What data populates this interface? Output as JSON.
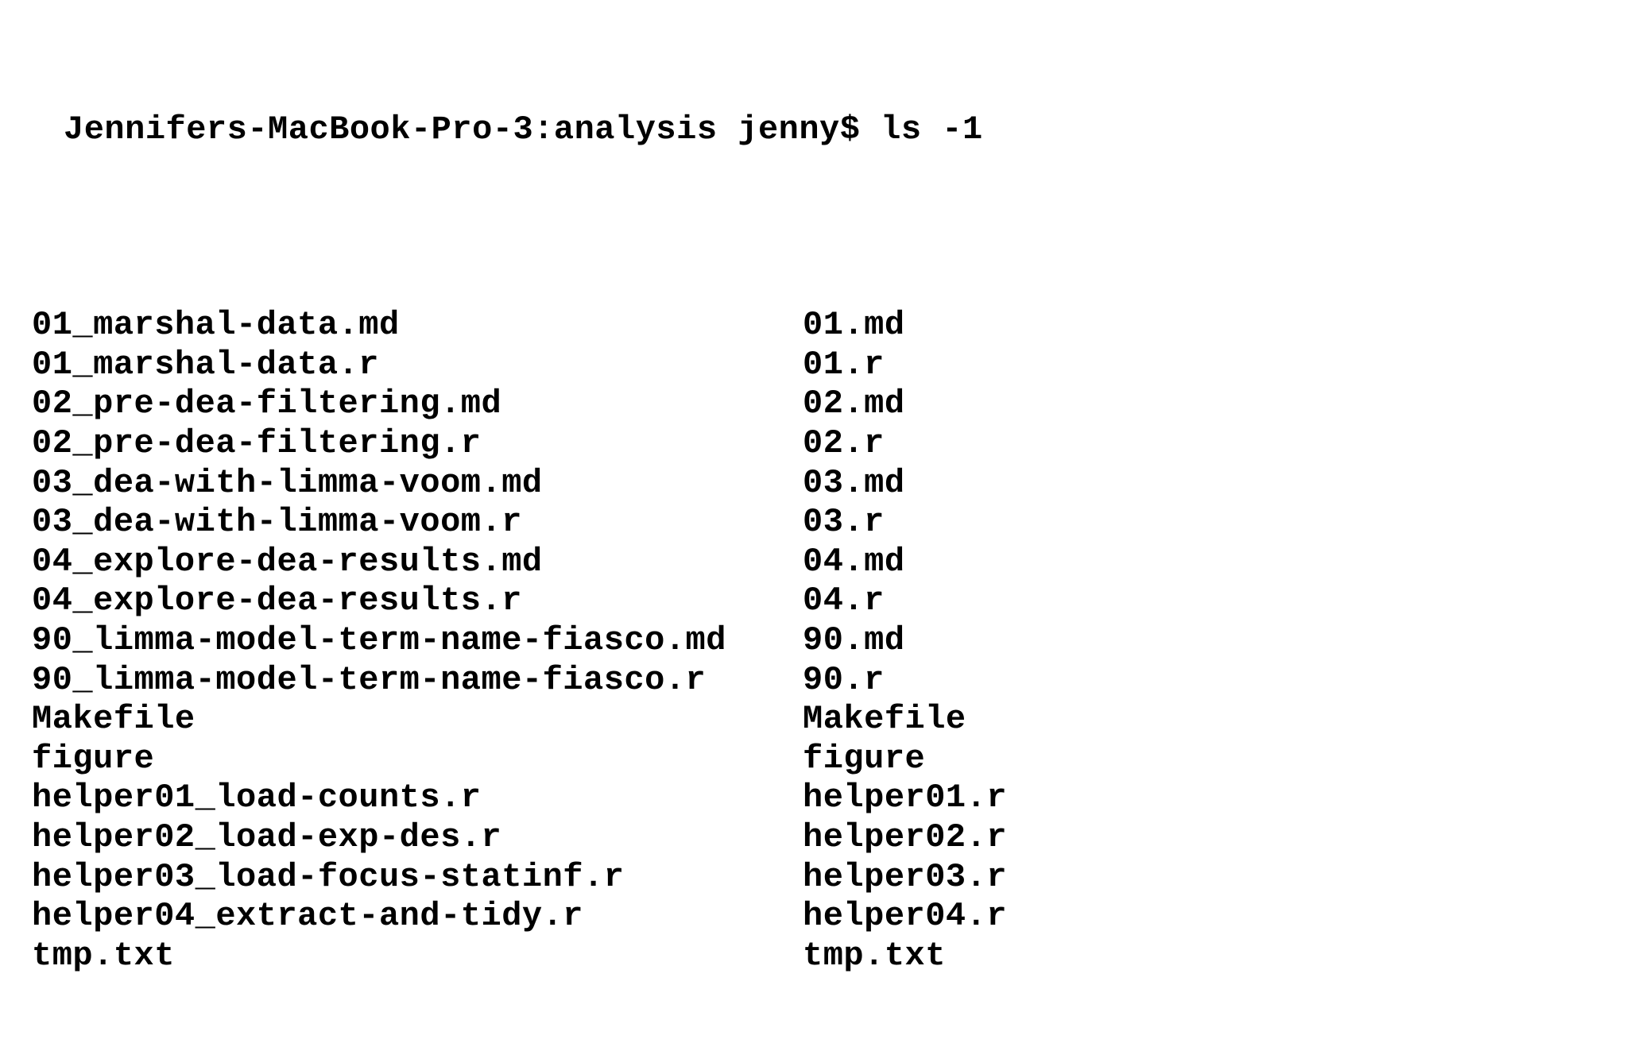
{
  "prompt": "Jennifers-MacBook-Pro-3:analysis jenny$ ls -1",
  "left_column": [
    "01_marshal-data.md",
    "01_marshal-data.r",
    "02_pre-dea-filtering.md",
    "02_pre-dea-filtering.r",
    "03_dea-with-limma-voom.md",
    "03_dea-with-limma-voom.r",
    "04_explore-dea-results.md",
    "04_explore-dea-results.r",
    "90_limma-model-term-name-fiasco.md",
    "90_limma-model-term-name-fiasco.r",
    "Makefile",
    "figure",
    "helper01_load-counts.r",
    "helper02_load-exp-des.r",
    "helper03_load-focus-statinf.r",
    "helper04_extract-and-tidy.r",
    "tmp.txt"
  ],
  "right_column": [
    "01.md",
    "01.r",
    "02.md",
    "02.r",
    "03.md",
    "03.r",
    "04.md",
    "04.r",
    "90.md",
    "90.r",
    "Makefile",
    "figure",
    "helper01.r",
    "helper02.r",
    "helper03.r",
    "helper04.r",
    "tmp.txt"
  ]
}
